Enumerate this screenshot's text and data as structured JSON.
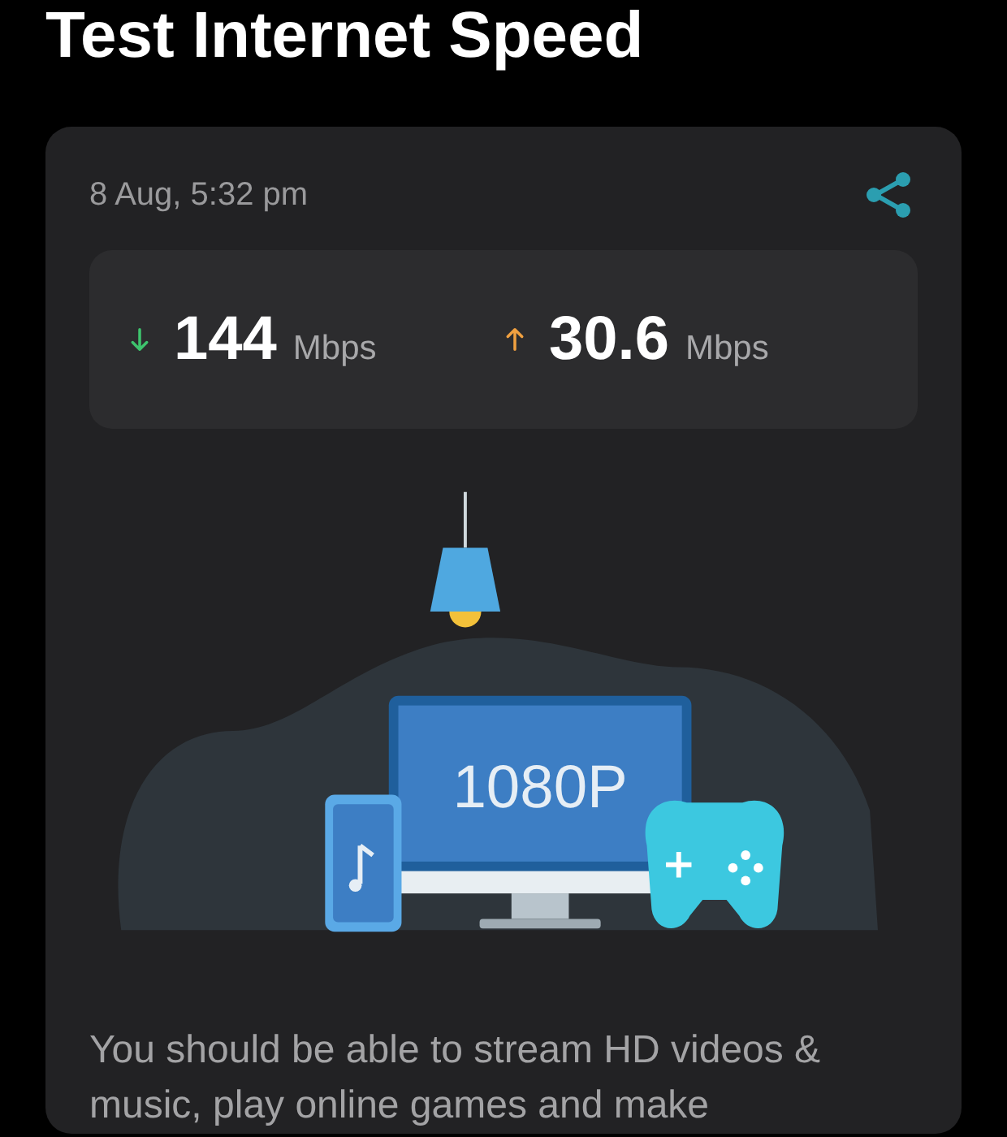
{
  "title": "Test Internet Speed",
  "result": {
    "timestamp": "8 Aug, 5:32 pm",
    "speeds": [
      {
        "kind": "download",
        "value": "144",
        "unit": "Mbps"
      },
      {
        "kind": "upload",
        "value": "30.6",
        "unit": "Mbps"
      }
    ],
    "illustration": {
      "screen_label": "1080P"
    },
    "description": "You should be able to stream HD videos & music, play online games and make"
  }
}
